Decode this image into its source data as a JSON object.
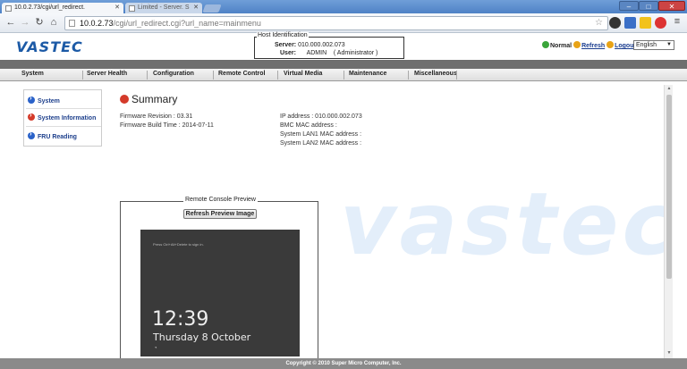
{
  "browser": {
    "tabs": [
      {
        "label": "10.0.2.73/cgi/url_redirect.",
        "active": true
      },
      {
        "label": "Limited - Server. S",
        "active": false
      }
    ],
    "url_host": "10.0.2.73",
    "url_path": "/cgi/url_redirect.cgi?url_name=mainmenu",
    "nav_icons": [
      "back-icon",
      "forward-icon",
      "reload-icon",
      "home-icon"
    ]
  },
  "header": {
    "logo": "VASTEC",
    "host_legend": "Host Identification",
    "server_label": "Server:",
    "server_value": "010.000.002.073",
    "user_label": "User:",
    "user_value": "ADMIN",
    "user_role": "( Administrator )",
    "status": "Normal",
    "refresh": "Refresh",
    "logout": "Logout",
    "language": "English"
  },
  "menu": [
    "System",
    "Server Health",
    "Configuration",
    "Remote Control",
    "Virtual Media",
    "Maintenance",
    "Miscellaneous"
  ],
  "sidebar": {
    "items": [
      {
        "label": "System",
        "color": "#2a62c9"
      },
      {
        "label": "System Information",
        "color": "#d43a2a"
      },
      {
        "label": "FRU Reading",
        "color": "#2a62c9"
      }
    ]
  },
  "summary": {
    "title": "Summary",
    "firmware_revision": "Firmware Revision : 03.31",
    "firmware_build_time": "Firmware Build Time : 2014-07-11",
    "ip_address": "IP address : 010.000.002.073",
    "bmc_mac": "BMC MAC address :",
    "lan1_mac": "System LAN1 MAC address :",
    "lan2_mac": "System LAN2 MAC address :"
  },
  "remote_console": {
    "legend": "Remote Console Preview",
    "refresh_button": "Refresh Preview Image",
    "screen_hint": "Press Ctrl+Alt+Delete to sign in.",
    "time": "12:39",
    "date": "Thursday 8 October"
  },
  "watermark": "vastec",
  "footer": "Copyright © 2010 Super Micro Computer, Inc.",
  "colors": {
    "accent": "#1c5aa6",
    "status_ok": "#3aa53a",
    "alert": "#d43a2a"
  }
}
